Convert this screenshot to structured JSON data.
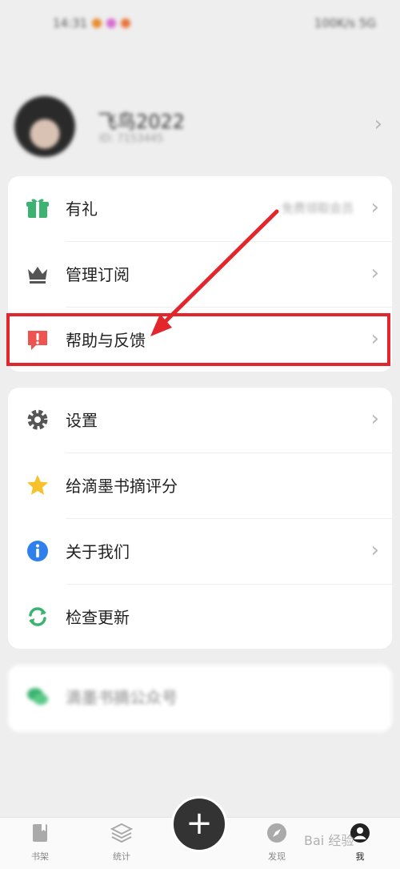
{
  "status": {
    "time": "14:31",
    "right": "100K/s 5G"
  },
  "profile": {
    "nickname": "飞鸟2022",
    "sub": "ID: 7153445"
  },
  "card1": {
    "rows": [
      {
        "label": "有礼",
        "value": "免费领取会员"
      },
      {
        "label": "管理订阅"
      },
      {
        "label": "帮助与反馈"
      }
    ]
  },
  "card2": {
    "rows": [
      {
        "label": "设置"
      },
      {
        "label": "给滴墨书摘评分"
      },
      {
        "label": "关于我们"
      },
      {
        "label": "检查更新"
      }
    ]
  },
  "card3": {
    "label": "滴墨书摘公众号"
  },
  "tabbar": {
    "tabs": [
      {
        "label": "书架"
      },
      {
        "label": "统计"
      },
      {
        "label": "发现"
      },
      {
        "label": "我"
      }
    ],
    "add": "+"
  },
  "watermark": "Bai 经验",
  "colors": {
    "accent": "#e3262b",
    "gift": "#3cb371",
    "help": "#ef5350",
    "info": "#2f80ed",
    "star": "#f6c12b"
  }
}
